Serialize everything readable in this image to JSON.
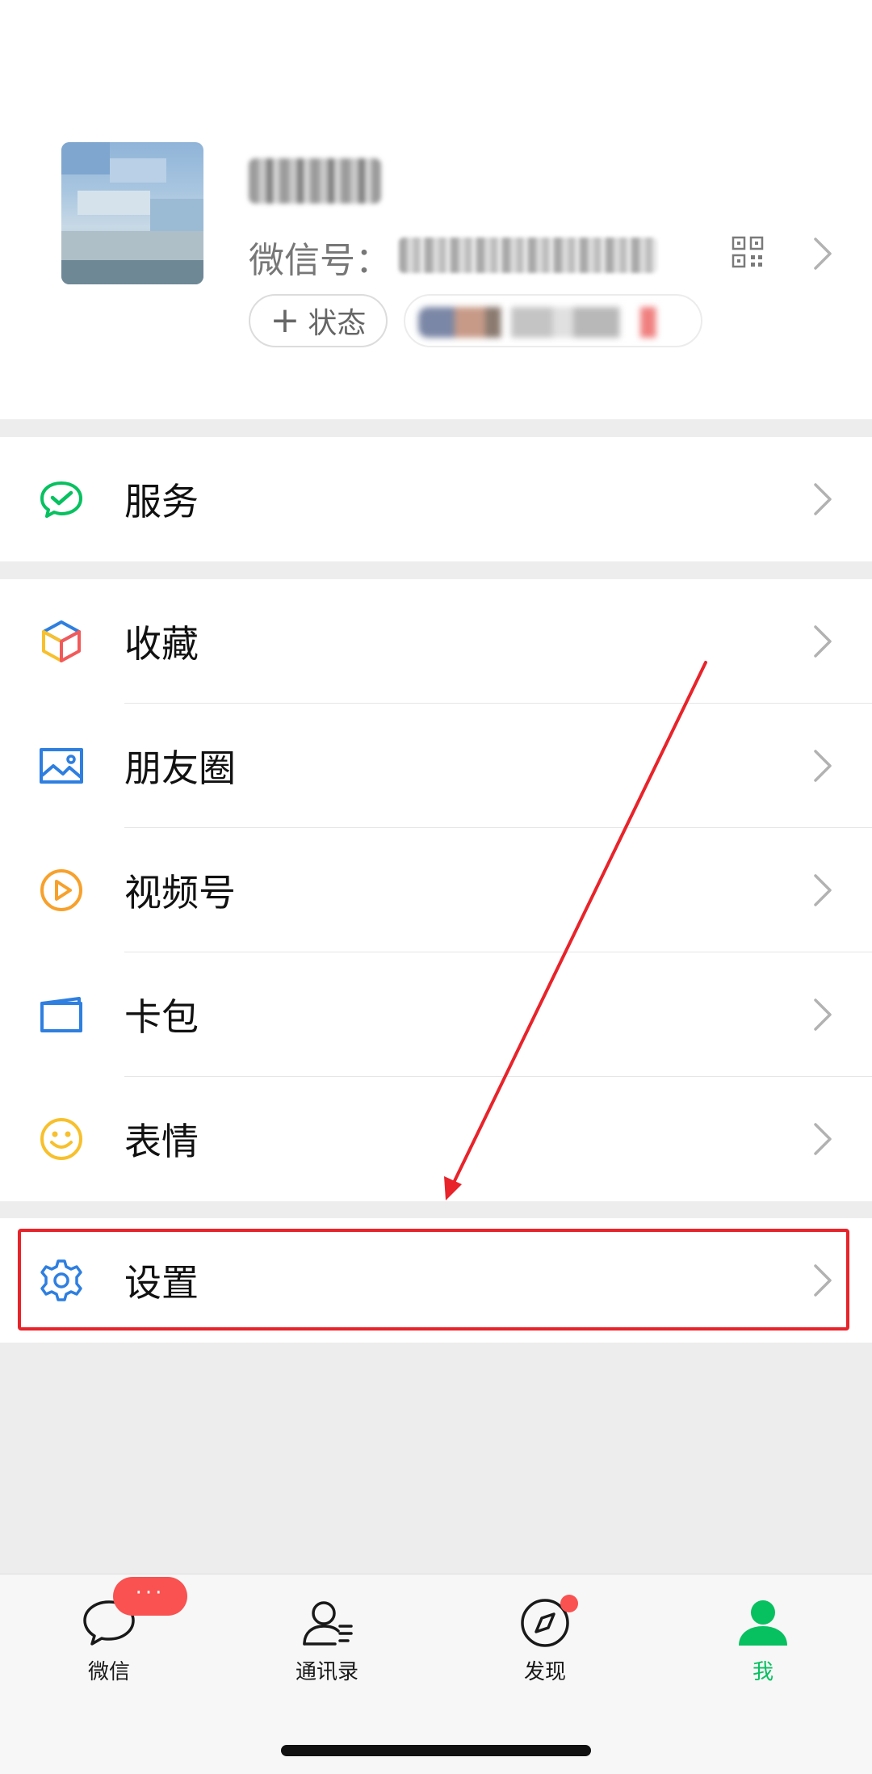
{
  "profile": {
    "wechat_id_label": "微信号：",
    "status_button_label": "状态",
    "icons": [
      "qr-code-icon",
      "chevron-right-icon",
      "plus-icon"
    ]
  },
  "menu": {
    "services": {
      "label": "服务",
      "icon": "wechat-pay-icon",
      "icon_color": "#07c160"
    },
    "favorites": {
      "label": "收藏",
      "icon": "cube-icon"
    },
    "moments": {
      "label": "朋友圈",
      "icon": "image-icon",
      "icon_color": "#2e7fe0"
    },
    "channels": {
      "label": "视频号",
      "icon": "play-circle-icon",
      "icon_color": "#f7a12c"
    },
    "cards": {
      "label": "卡包",
      "icon": "card-wallet-icon",
      "icon_color": "#2e7fe0"
    },
    "stickers": {
      "label": "表情",
      "icon": "smiley-icon",
      "icon_color": "#f7c02c"
    },
    "settings": {
      "label": "设置",
      "icon": "gear-icon",
      "icon_color": "#2e7fe0"
    }
  },
  "tabbar": {
    "chats": {
      "label": "微信",
      "icon": "chat-bubble-icon",
      "badge": "···"
    },
    "contacts": {
      "label": "通讯录",
      "icon": "contacts-icon"
    },
    "discover": {
      "label": "发现",
      "icon": "compass-icon"
    },
    "me": {
      "label": "我",
      "icon": "person-icon",
      "active": true
    }
  },
  "colors": {
    "accent_green": "#07c160",
    "badge_red": "#fa5151",
    "annotation_red": "#e8232a"
  }
}
